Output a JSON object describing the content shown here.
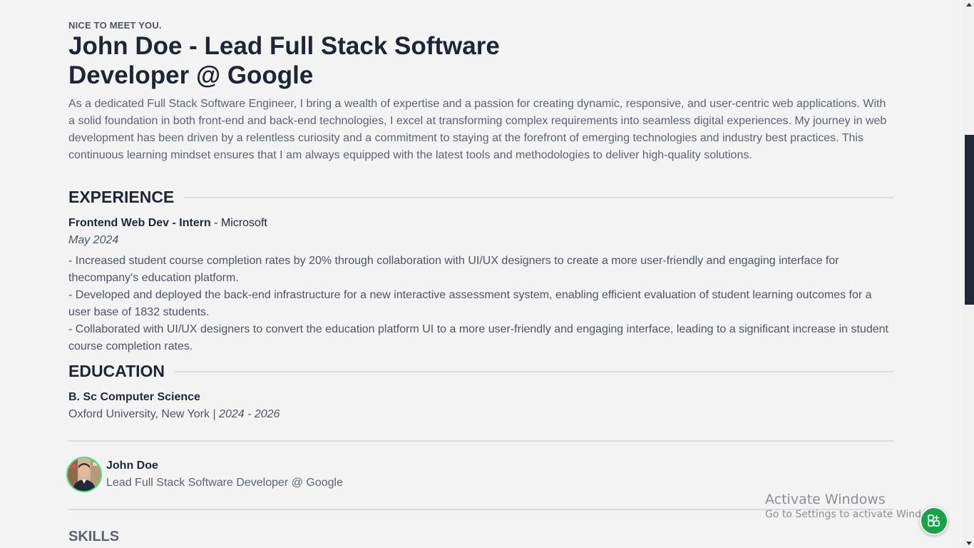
{
  "intro": {
    "eyebrow": "NICE TO MEET YOU.",
    "title": "John Doe - Lead Full Stack Software Developer @ Google",
    "bio": "As a dedicated Full Stack Software Engineer, I bring a wealth of expertise and a passion for creating dynamic, responsive, and user-centric web applications. With a solid foundation in both front-end and back-end technologies, I excel at transforming complex requirements into seamless digital experiences. My journey in web development has been driven by a relentless curiosity and a commitment to staying at the forefront of emerging technologies and industry best practices. This continuous learning mindset ensures that I am always equipped with the latest tools and methodologies to deliver high-quality solutions."
  },
  "experience": {
    "heading": "EXPERIENCE",
    "items": [
      {
        "title": "Frontend Web Dev - Intern",
        "separator": " - ",
        "company": "Microsoft",
        "date": "May 2024",
        "bullets": [
          "- Increased student course completion rates by 20% through collaboration with UI/UX designers to create a more user-friendly and engaging interface for thecompany's education platform.",
          "- Developed and deployed the back-end infrastructure for a new interactive assessment system, enabling efficient evaluation of student learning outcomes for a user base of 1832 students.",
          "- Collaborated with UI/UX designers to convert the education platform UI to a more user-friendly and engaging interface, leading to a significant increase in student course completion rates."
        ]
      }
    ]
  },
  "education": {
    "heading": "EDUCATION",
    "items": [
      {
        "degree": "B. Sc Computer Science",
        "school": "Oxford University, New York | ",
        "years": "2024 - 2026"
      }
    ]
  },
  "profile": {
    "name": "John Doe",
    "role": "Lead Full Stack Software Developer @ Google"
  },
  "skills": {
    "heading": "SKILLS"
  },
  "watermark": {
    "title": "Activate Windows",
    "subtitle": "Go to Settings to activate Windows."
  },
  "colors": {
    "background": "#f3f3f3",
    "heading": "#1e2533",
    "muted": "#5b6470",
    "accent": "#16a34a",
    "avatar_ring": "#4ade80",
    "scroll_thumb": "#1f2937"
  },
  "icons": {
    "fab": "apps-plus-icon",
    "avatar": "user-photo"
  }
}
